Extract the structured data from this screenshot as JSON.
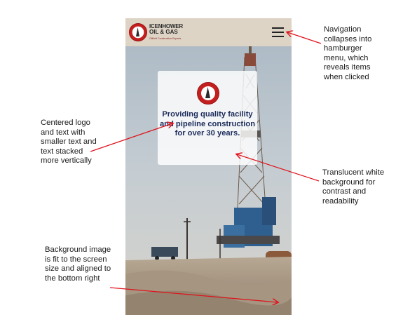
{
  "phone": {
    "brand": {
      "name_line1": "ICENHOWER",
      "name_line2": "OIL & GAS",
      "tagline": "Oilfield Construction Experts"
    },
    "menu_icon": "hamburger-menu-icon",
    "hero": {
      "logo_icon": "oil-derrick-logo-icon",
      "text": "Providing quality facility and pipeline construction for over 30 years."
    }
  },
  "annotations": {
    "navigation": "Navigation collapses into hamburger menu, which reveals items when clicked",
    "centered": "Centered logo and text with smaller text and text stacked more vertically",
    "translucent": "Translucent white background for contrast and readability",
    "background": "Background image is fit to the screen size and aligned to the bottom right"
  },
  "colors": {
    "topbar": "#ddd4c6",
    "heading": "#1d2c5c",
    "logo_red": "#c41f1f",
    "arrow": "#e0121b"
  }
}
